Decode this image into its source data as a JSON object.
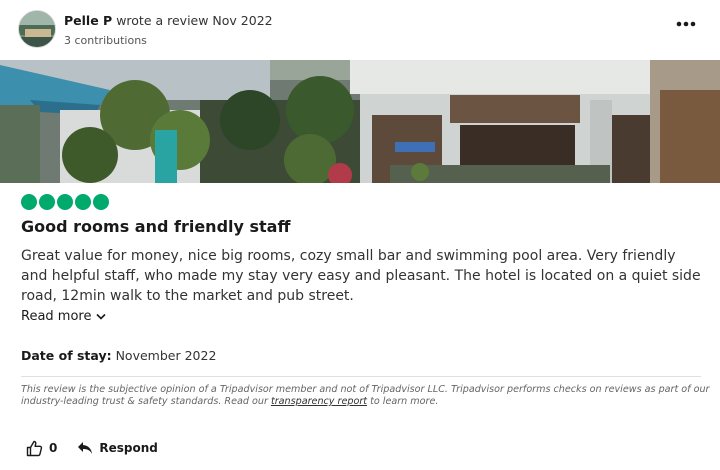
{
  "review": {
    "author_name": "Pelle P",
    "action_text": "wrote a review Nov 2022",
    "contributions": "3 contributions",
    "rating": 5,
    "title": "Good rooms and friendly staff",
    "body": "Great value for money, nice big rooms, cozy small bar and swimming pool area. Very friendly and helpful staff, who made my stay very easy and pleasant. The hotel is located on a quiet side road, 12min walk to the market and pub street.",
    "read_more_label": "Read more",
    "date_of_stay_label": "Date of stay:",
    "date_of_stay_value": " November 2022"
  },
  "disclaimer": {
    "text_before": "This review is the subjective opinion of a Tripadvisor member and not of Tripadvisor LLC. Tripadvisor performs checks on reviews as part of our industry-leading trust & safety standards. Read our ",
    "link_text": "transparency report",
    "text_after": " to learn more."
  },
  "actions": {
    "helpful_count": "0",
    "respond_label": "Respond"
  },
  "icons": {
    "more": "more-options-icon",
    "like": "thumbs-up-icon",
    "respond": "reply-arrow-icon",
    "read_more": "chevron-down-icon"
  },
  "colors": {
    "rating_bubble": "#00aa6c",
    "text_primary": "#1a1a1a",
    "text_secondary": "#333333"
  }
}
